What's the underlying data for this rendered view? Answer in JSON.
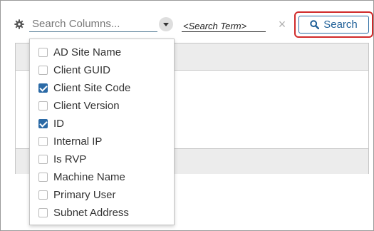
{
  "toolbar": {
    "column_search_placeholder": "Search Columns...",
    "search_term_text": "<Search Term>",
    "clear_symbol": "×",
    "search_button_label": "Search"
  },
  "dropdown": {
    "options": [
      {
        "label": "AD Site Name",
        "checked": false
      },
      {
        "label": "Client GUID",
        "checked": false
      },
      {
        "label": "Client Site Code",
        "checked": true
      },
      {
        "label": "Client Version",
        "checked": false
      },
      {
        "label": "ID",
        "checked": true
      },
      {
        "label": "Internal IP",
        "checked": false
      },
      {
        "label": "Is RVP",
        "checked": false
      },
      {
        "label": "Machine Name",
        "checked": false
      },
      {
        "label": "Primary User",
        "checked": false
      },
      {
        "label": "Subnet Address",
        "checked": false
      }
    ]
  },
  "colors": {
    "accent": "#2b6aa6",
    "highlight_ring": "#d02a2a",
    "panel_header": "#ececec"
  },
  "icons": {
    "settings": "gear-icon",
    "dropdown": "chevron-down-icon",
    "clear": "close-icon",
    "search": "search-icon"
  }
}
